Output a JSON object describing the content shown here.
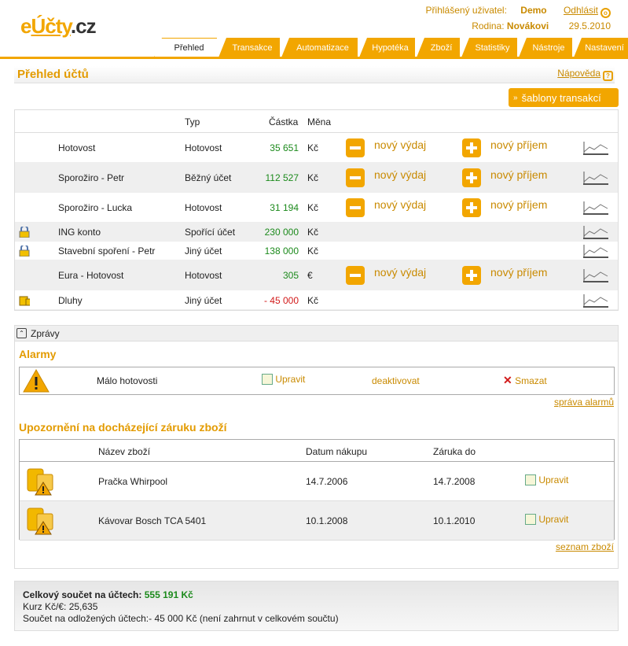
{
  "header": {
    "logo_e": "e",
    "logo_mid": "Účty",
    "logo_cz": ".cz",
    "user_label": "Přihlášený uživatel:",
    "user_name": "Demo",
    "logout": "Odhlásit",
    "family_label": "Rodina:",
    "family_name": "Novákovi",
    "date": "29.5.2010"
  },
  "tabs": [
    "Přehled",
    "Transakce",
    "Automatizace",
    "Hypotéka",
    "Zboží",
    "Statistiky",
    "Nástroje",
    "Nastavení"
  ],
  "page": {
    "title": "Přehled účtů",
    "help": "Nápověda",
    "templates_button": "šablony transakcí"
  },
  "accounts": {
    "headers": {
      "type": "Typ",
      "amount": "Částka",
      "currency": "Měna"
    },
    "expense_label": "nový výdaj",
    "income_label": "nový příjem",
    "rows": [
      {
        "name": "Hotovost",
        "type": "Hotovost",
        "amount": "35 651",
        "currency": "Kč",
        "actions": true,
        "icon": ""
      },
      {
        "name": "Sporožiro - Petr",
        "type": "Běžný účet",
        "amount": "112 527",
        "currency": "Kč",
        "actions": true,
        "icon": ""
      },
      {
        "name": "Sporožiro - Lucka",
        "type": "Hotovost",
        "amount": "31 194",
        "currency": "Kč",
        "actions": true,
        "icon": ""
      },
      {
        "name": "ING konto",
        "type": "Spořící účet",
        "amount": "230 000",
        "currency": "Kč",
        "actions": false,
        "icon": "lock-icon"
      },
      {
        "name": "Stavební spoření - Petr",
        "type": "Jiný účet",
        "amount": "138 000",
        "currency": "Kč",
        "actions": false,
        "icon": "lock-icon"
      },
      {
        "name": "Eura - Hotovost",
        "type": "Hotovost",
        "amount": "305",
        "currency": "€",
        "actions": true,
        "icon": ""
      },
      {
        "name": "Dluhy",
        "type": "Jiný účet",
        "amount": "- 45 000",
        "currency": "Kč",
        "actions": false,
        "icon": "debt-icon"
      }
    ]
  },
  "messages": {
    "bar_label": "Zprávy",
    "alarms_title": "Alarmy",
    "alarm": {
      "text": "Málo hotovosti",
      "edit": "Upravit",
      "deactivate": "deaktivovat",
      "delete": "Smazat"
    },
    "alarm_manage": "správa alarmů",
    "warranty_title": "Upozornění na docházející záruku zboží",
    "warranty_headers": {
      "name": "Název zboží",
      "bought": "Datum nákupu",
      "until": "Záruka do"
    },
    "warranty_rows": [
      {
        "name": "Pračka Whirpool",
        "bought": "14.7.2006",
        "until": "14.7.2008",
        "edit": "Upravit"
      },
      {
        "name": "Kávovar Bosch TCA 5401",
        "bought": "10.1.2008",
        "until": "10.1.2010",
        "edit": "Upravit"
      }
    ],
    "goods_list": "seznam zboží"
  },
  "totals": {
    "label": "Celkový součet na účtech:",
    "value": "555 191 Kč",
    "rate": "Kurz Kč/€: 25,635",
    "deferred": "Součet na odložených účtech:- 45 000 Kč (není zahrnut v celkovém součtu)"
  },
  "colors": {
    "accent": "#f2a600",
    "positive": "#1c8a1c",
    "negative": "#d21a1a"
  }
}
